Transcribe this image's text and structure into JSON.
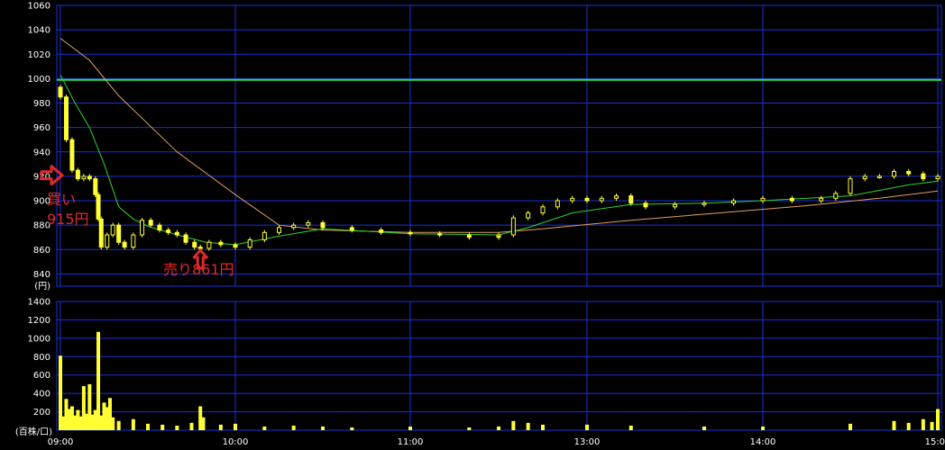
{
  "chart_data": [
    {
      "type": "candlestick",
      "panel": "price",
      "unit_label": "(円)",
      "ylim": [
        830,
        1060
      ],
      "yticks": [
        "1060",
        "1040",
        "1020",
        "1000",
        "980",
        "960",
        "940",
        "920",
        "900",
        "880",
        "860",
        "840"
      ],
      "ytick_values": [
        1060,
        1040,
        1020,
        1000,
        980,
        960,
        940,
        920,
        900,
        880,
        860,
        840
      ],
      "xticks": [
        "09:00",
        "10:00",
        "11:00",
        "13:00",
        "14:00",
        "15:00"
      ],
      "reference_line": {
        "value": 999,
        "color": "#27e04a"
      },
      "close_series": [
        {
          "t": "09:00",
          "v": 985
        },
        {
          "t": "09:02",
          "v": 950
        },
        {
          "t": "09:04",
          "v": 925
        },
        {
          "t": "09:06",
          "v": 918
        },
        {
          "t": "09:08",
          "v": 920
        },
        {
          "t": "09:10",
          "v": 918
        },
        {
          "t": "09:12",
          "v": 905
        },
        {
          "t": "09:13",
          "v": 885
        },
        {
          "t": "09:14",
          "v": 862
        },
        {
          "t": "09:16",
          "v": 872
        },
        {
          "t": "09:18",
          "v": 880
        },
        {
          "t": "09:20",
          "v": 866
        },
        {
          "t": "09:22",
          "v": 862
        },
        {
          "t": "09:25",
          "v": 872
        },
        {
          "t": "09:28",
          "v": 884
        },
        {
          "t": "09:31",
          "v": 880
        },
        {
          "t": "09:34",
          "v": 876
        },
        {
          "t": "09:37",
          "v": 874
        },
        {
          "t": "09:40",
          "v": 872
        },
        {
          "t": "09:43",
          "v": 866
        },
        {
          "t": "09:46",
          "v": 862
        },
        {
          "t": "09:48",
          "v": 861
        },
        {
          "t": "09:51",
          "v": 866
        },
        {
          "t": "09:55",
          "v": 864
        },
        {
          "t": "10:00",
          "v": 862
        },
        {
          "t": "10:05",
          "v": 868
        },
        {
          "t": "10:10",
          "v": 874
        },
        {
          "t": "10:15",
          "v": 878
        },
        {
          "t": "10:20",
          "v": 880
        },
        {
          "t": "10:25",
          "v": 882
        },
        {
          "t": "10:30",
          "v": 878
        },
        {
          "t": "10:40",
          "v": 876
        },
        {
          "t": "10:50",
          "v": 874
        },
        {
          "t": "11:00",
          "v": 873
        },
        {
          "t": "11:10",
          "v": 872
        },
        {
          "t": "11:20",
          "v": 870
        },
        {
          "t": "11:30",
          "v": 871
        },
        {
          "t": "12:30",
          "v": 872
        },
        {
          "t": "12:35",
          "v": 886
        },
        {
          "t": "12:40",
          "v": 890
        },
        {
          "t": "12:45",
          "v": 895
        },
        {
          "t": "12:50",
          "v": 900
        },
        {
          "t": "12:55",
          "v": 902
        },
        {
          "t": "13:00",
          "v": 900
        },
        {
          "t": "13:05",
          "v": 902
        },
        {
          "t": "13:10",
          "v": 904
        },
        {
          "t": "13:15",
          "v": 898
        },
        {
          "t": "13:20",
          "v": 895
        },
        {
          "t": "13:30",
          "v": 897
        },
        {
          "t": "13:40",
          "v": 898
        },
        {
          "t": "13:50",
          "v": 900
        },
        {
          "t": "14:00",
          "v": 902
        },
        {
          "t": "14:10",
          "v": 900
        },
        {
          "t": "14:20",
          "v": 902
        },
        {
          "t": "14:25",
          "v": 906
        },
        {
          "t": "14:30",
          "v": 918
        },
        {
          "t": "14:35",
          "v": 920
        },
        {
          "t": "14:40",
          "v": 920
        },
        {
          "t": "14:45",
          "v": 924
        },
        {
          "t": "14:50",
          "v": 922
        },
        {
          "t": "14:55",
          "v": 918
        },
        {
          "t": "15:00",
          "v": 920
        }
      ],
      "ma_short": [
        {
          "t": "09:00",
          "v": 1003
        },
        {
          "t": "09:05",
          "v": 980
        },
        {
          "t": "09:10",
          "v": 960
        },
        {
          "t": "09:15",
          "v": 930
        },
        {
          "t": "09:20",
          "v": 895
        },
        {
          "t": "09:25",
          "v": 885
        },
        {
          "t": "09:30",
          "v": 879
        },
        {
          "t": "09:40",
          "v": 872
        },
        {
          "t": "09:50",
          "v": 866
        },
        {
          "t": "10:00",
          "v": 864
        },
        {
          "t": "10:15",
          "v": 871
        },
        {
          "t": "10:30",
          "v": 877
        },
        {
          "t": "11:00",
          "v": 873
        },
        {
          "t": "11:30",
          "v": 872
        },
        {
          "t": "12:40",
          "v": 878
        },
        {
          "t": "12:55",
          "v": 890
        },
        {
          "t": "13:15",
          "v": 897
        },
        {
          "t": "13:40",
          "v": 898
        },
        {
          "t": "14:00",
          "v": 900
        },
        {
          "t": "14:30",
          "v": 904
        },
        {
          "t": "14:50",
          "v": 913
        },
        {
          "t": "15:00",
          "v": 916
        }
      ],
      "ma_long": [
        {
          "t": "09:00",
          "v": 1033
        },
        {
          "t": "09:10",
          "v": 1015
        },
        {
          "t": "09:20",
          "v": 986
        },
        {
          "t": "09:40",
          "v": 940
        },
        {
          "t": "10:00",
          "v": 905
        },
        {
          "t": "10:15",
          "v": 880
        },
        {
          "t": "10:30",
          "v": 876
        },
        {
          "t": "11:00",
          "v": 874
        },
        {
          "t": "11:30",
          "v": 874
        },
        {
          "t": "12:45",
          "v": 877
        },
        {
          "t": "13:15",
          "v": 884
        },
        {
          "t": "13:45",
          "v": 890
        },
        {
          "t": "14:15",
          "v": 896
        },
        {
          "t": "14:40",
          "v": 902
        },
        {
          "t": "15:00",
          "v": 908
        }
      ],
      "annotations": [
        {
          "text": "買い",
          "text2": "915円",
          "marker": "arrow-right",
          "t": "09:00",
          "price": 915
        },
        {
          "text": "売り861円",
          "marker": "arrow-up",
          "t": "09:48",
          "price": 861
        }
      ],
      "colors": {
        "candles": "#ffff33",
        "ma_short": "#2fd32f",
        "ma_long": "#e0a060",
        "grid": "#1a2fd8",
        "annotation": "#e02a2a"
      }
    },
    {
      "type": "bar",
      "panel": "volume",
      "unit_label": "(百株/口)",
      "ylim": [
        0,
        1400
      ],
      "yticks": [
        "1400",
        "1200",
        "1000",
        "800",
        "600",
        "400",
        "200",
        "0"
      ],
      "ytick_values": [
        1400,
        1200,
        1000,
        800,
        600,
        400,
        200,
        0
      ],
      "xticks": [
        "09:00",
        "10:00",
        "11:00",
        "13:00",
        "14:00",
        "15:00"
      ],
      "volumes": [
        {
          "t": "09:00",
          "v": 810
        },
        {
          "t": "09:01",
          "v": 150
        },
        {
          "t": "09:02",
          "v": 340
        },
        {
          "t": "09:03",
          "v": 230
        },
        {
          "t": "09:04",
          "v": 260
        },
        {
          "t": "09:05",
          "v": 160
        },
        {
          "t": "09:06",
          "v": 220
        },
        {
          "t": "09:07",
          "v": 150
        },
        {
          "t": "09:08",
          "v": 480
        },
        {
          "t": "09:09",
          "v": 180
        },
        {
          "t": "09:10",
          "v": 500
        },
        {
          "t": "09:11",
          "v": 170
        },
        {
          "t": "09:12",
          "v": 220
        },
        {
          "t": "09:13",
          "v": 1070
        },
        {
          "t": "09:14",
          "v": 160
        },
        {
          "t": "09:15",
          "v": 300
        },
        {
          "t": "09:16",
          "v": 250
        },
        {
          "t": "09:17",
          "v": 350
        },
        {
          "t": "09:18",
          "v": 140
        },
        {
          "t": "09:20",
          "v": 100
        },
        {
          "t": "09:25",
          "v": 120
        },
        {
          "t": "09:30",
          "v": 70
        },
        {
          "t": "09:35",
          "v": 60
        },
        {
          "t": "09:40",
          "v": 50
        },
        {
          "t": "09:45",
          "v": 80
        },
        {
          "t": "09:48",
          "v": 260
        },
        {
          "t": "09:49",
          "v": 140
        },
        {
          "t": "09:55",
          "v": 60
        },
        {
          "t": "10:00",
          "v": 70
        },
        {
          "t": "10:10",
          "v": 40
        },
        {
          "t": "10:20",
          "v": 50
        },
        {
          "t": "10:30",
          "v": 40
        },
        {
          "t": "10:40",
          "v": 30
        },
        {
          "t": "11:00",
          "v": 40
        },
        {
          "t": "11:20",
          "v": 30
        },
        {
          "t": "12:30",
          "v": 40
        },
        {
          "t": "12:35",
          "v": 100
        },
        {
          "t": "12:40",
          "v": 80
        },
        {
          "t": "12:45",
          "v": 60
        },
        {
          "t": "13:00",
          "v": 60
        },
        {
          "t": "13:15",
          "v": 50
        },
        {
          "t": "13:40",
          "v": 40
        },
        {
          "t": "14:00",
          "v": 40
        },
        {
          "t": "14:30",
          "v": 70
        },
        {
          "t": "14:45",
          "v": 100
        },
        {
          "t": "14:50",
          "v": 80
        },
        {
          "t": "14:55",
          "v": 120
        },
        {
          "t": "14:58",
          "v": 90
        },
        {
          "t": "15:00",
          "v": 230
        }
      ],
      "colors": {
        "bars": "#ffff33",
        "grid": "#1a2fd8"
      }
    }
  ]
}
